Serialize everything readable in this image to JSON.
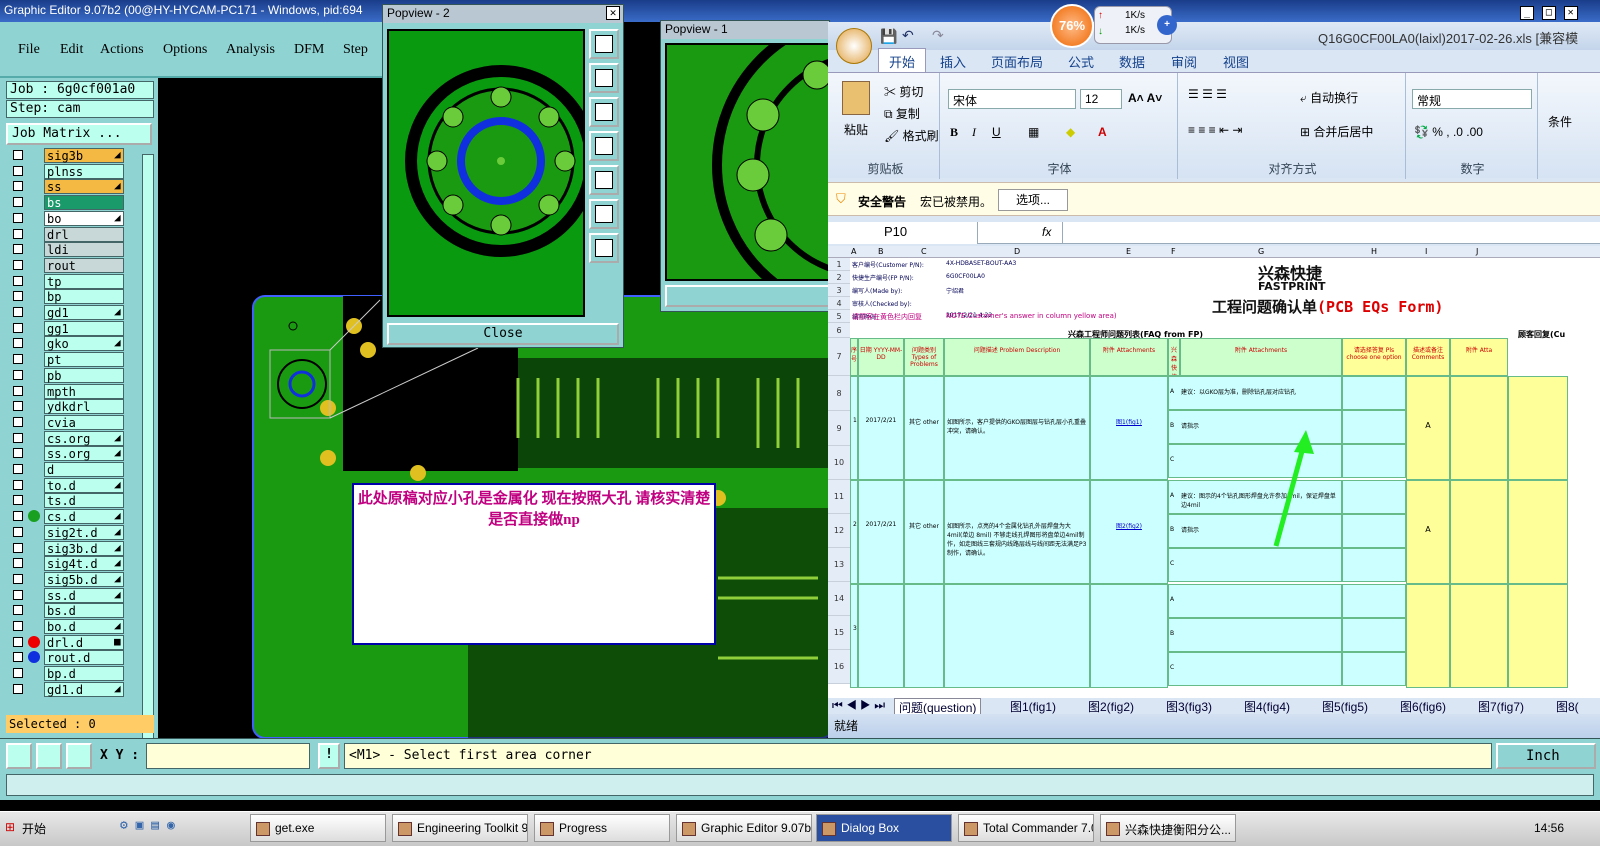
{
  "ge": {
    "title": "Graphic Editor 9.07b2 (00@HY-HYCAM-PC171 - Windows, pid:694",
    "menu": [
      "File",
      "Edit",
      "Actions",
      "Options",
      "Analysis",
      "DFM",
      "Step"
    ],
    "job": "Job : 6g0cf001a0",
    "step": "Step: cam",
    "job_matrix": "Job Matrix ...",
    "layers": [
      {
        "name": "sig3b",
        "bg": "#f4b942",
        "mk": "◢",
        "dot": ""
      },
      {
        "name": "plnss",
        "bg": "#bfe",
        "mk": "",
        "dot": ""
      },
      {
        "name": "ss",
        "bg": "#f4b942",
        "mk": "◢",
        "dot": ""
      },
      {
        "name": "bs",
        "bg": "#1a9a6a",
        "mk": "",
        "dot": ""
      },
      {
        "name": "bo",
        "bg": "#ffffff",
        "mk": "◢",
        "dot": ""
      },
      {
        "name": "drl",
        "bg": "#c8d8d8",
        "mk": "",
        "dot": ""
      },
      {
        "name": "ldi",
        "bg": "#c8d8d8",
        "mk": "",
        "dot": ""
      },
      {
        "name": "rout",
        "bg": "#c8d8d8",
        "mk": "",
        "dot": ""
      },
      {
        "name": "tp",
        "bg": "#bfe",
        "mk": "",
        "dot": ""
      },
      {
        "name": "bp",
        "bg": "#bfe",
        "mk": "",
        "dot": ""
      },
      {
        "name": "gd1",
        "bg": "#bfe",
        "mk": "◢",
        "dot": ""
      },
      {
        "name": "gg1",
        "bg": "#bfe",
        "mk": "",
        "dot": ""
      },
      {
        "name": "gko",
        "bg": "#bfe",
        "mk": "◢",
        "dot": ""
      },
      {
        "name": "pt",
        "bg": "#bfe",
        "mk": "",
        "dot": ""
      },
      {
        "name": "pb",
        "bg": "#bfe",
        "mk": "",
        "dot": ""
      },
      {
        "name": "mpth",
        "bg": "#bfe",
        "mk": "",
        "dot": ""
      },
      {
        "name": "ydkdrl",
        "bg": "#bfe",
        "mk": "",
        "dot": ""
      },
      {
        "name": "cvia",
        "bg": "#bfe",
        "mk": "",
        "dot": ""
      },
      {
        "name": "cs.org",
        "bg": "#bfe",
        "mk": "◢",
        "dot": ""
      },
      {
        "name": "ss.org",
        "bg": "#bfe",
        "mk": "◢",
        "dot": ""
      },
      {
        "name": "d",
        "bg": "#bfe",
        "mk": "",
        "dot": ""
      },
      {
        "name": "to.d",
        "bg": "#bfe",
        "mk": "◢",
        "dot": ""
      },
      {
        "name": "ts.d",
        "bg": "#bfe",
        "mk": "",
        "dot": ""
      },
      {
        "name": "cs.d",
        "bg": "#bfe",
        "mk": "◢",
        "dot": "#1aa020"
      },
      {
        "name": "sig2t.d",
        "bg": "#bfe",
        "mk": "◢",
        "dot": ""
      },
      {
        "name": "sig3b.d",
        "bg": "#bfe",
        "mk": "◢",
        "dot": ""
      },
      {
        "name": "sig4t.d",
        "bg": "#bfe",
        "mk": "◢",
        "dot": ""
      },
      {
        "name": "sig5b.d",
        "bg": "#bfe",
        "mk": "◢",
        "dot": ""
      },
      {
        "name": "ss.d",
        "bg": "#bfe",
        "mk": "◢",
        "dot": ""
      },
      {
        "name": "bs.d",
        "bg": "#bfe",
        "mk": "",
        "dot": ""
      },
      {
        "name": "bo.d",
        "bg": "#bfe",
        "mk": "◢",
        "dot": ""
      },
      {
        "name": "drl.d",
        "bg": "#bfe",
        "mk": "■",
        "dot": "#e00"
      },
      {
        "name": "rout.d",
        "bg": "#bfe",
        "mk": "",
        "dot": "#1030e0"
      },
      {
        "name": "bp.d",
        "bg": "#bfe",
        "mk": "",
        "dot": ""
      },
      {
        "name": "gd1.d",
        "bg": "#bfe",
        "mk": "◢",
        "dot": ""
      }
    ],
    "selected": "Selected : 0",
    "xy_label": "X Y :",
    "xy_value": "",
    "prompt": "<M1> - Select first area corner",
    "units": "Inch",
    "note": "此处原稿对应小孔是金属化   现在按照大孔  请核实清楚是否直接做np",
    "popview2": {
      "title": "Popview - 2",
      "close": "Close"
    },
    "popview1": {
      "title": "Popview - 1"
    },
    "netmeter": {
      "percent": "76%",
      "up": "1K/s",
      "down": "1K/s"
    }
  },
  "excel": {
    "title": "Q16G0CF00LA0(laixl)2017-02-26.xls  [兼容模",
    "tabs": [
      "开始",
      "插入",
      "页面布局",
      "公式",
      "数据",
      "审阅",
      "视图"
    ],
    "clipboard": {
      "paste": "粘贴",
      "cut": "剪切",
      "copy": "复制",
      "format_painter": "格式刷",
      "label": "剪贴板"
    },
    "font": {
      "name": "宋体",
      "size": "12",
      "label": "字体"
    },
    "align": {
      "wrap": "自动换行",
      "merge": "合并后居中",
      "label": "对齐方式"
    },
    "number": {
      "format": "常规",
      "label": "数字",
      "cond": "条件"
    },
    "security": {
      "title": "安全警告",
      "msg": "宏已被禁用。",
      "btn": "选项..."
    },
    "namebox": "P10",
    "fx": "fx",
    "col_heads": [
      "A",
      "B",
      "C",
      "D",
      "E",
      "F",
      "G",
      "H",
      "I",
      "J"
    ],
    "info_rows": [
      {
        "label": "客户编号(Customer P/N):",
        "value": "4X-HDBASET-BOUT-AA3"
      },
      {
        "label": "快捷生产编号(FP P/N):",
        "value": "6G0CF00LA0"
      },
      {
        "label": "编写人(Made by):",
        "value": "宁绍君"
      },
      {
        "label": "审核人(Checked by):",
        "value": ""
      },
      {
        "label": "编写时间",
        "value": "2017/2/21 4:22"
      }
    ],
    "note_row": "请顾客在黄色栏内回复",
    "note_en": "NOTE:Customer's answer in column yellow area)",
    "logo_cn": "兴森快捷",
    "logo_en": "FASTPRINT",
    "form_title": "工程问题确认单",
    "form_title_en": "(PCB EQs Form)",
    "section_fp": "兴森工程师问题列表(FAQ from FP)",
    "section_cust": "顾客回复(Cu",
    "headers": [
      "序号",
      "日期 YYYY-MM-DD",
      "问题类别 Types of Problems",
      "问题描述 Problem Description",
      "附件 Attachments",
      "兴森快捷建议 (Recommendation,suggestion)",
      "附件 Attachments",
      "请选择答复 Pls choose one option",
      "描述或备注 Comments",
      "附件 Atta"
    ],
    "rows": [
      {
        "no": "1",
        "date": "2017/2/21",
        "type": "其它 other",
        "desc": "如图所示，客户提供的GKO层图层与钻孔层小孔重叠冲突，请确认。",
        "att": "图1(fig1)",
        "a": "建议：以GKO层为准，删除钻孔层对应钻孔",
        "b": "请指示",
        "choice": "A"
      },
      {
        "no": "2",
        "date": "2017/2/21",
        "type": "其它 other",
        "desc": "如图所示，点亮的4个金属化钻孔外层焊盘为大4mil(单边 8mil) 不够走线孔焊图形将盘单边4mil制作，如走图线三套规内线路层线与线间距无法满足P3制作，请确认。",
        "att": "图2(fig2)",
        "a": "建议：图示的4个钻孔图形焊盘允许参加3mil，保证焊盘单边4mil",
        "b": "请指示",
        "choice": "A"
      },
      {
        "no": "3",
        "date": "",
        "type": "",
        "desc": "",
        "att": "",
        "a": "",
        "b": "",
        "choice": ""
      }
    ],
    "sheet_tabs": [
      "问题(question)",
      "图1(fig1)",
      "图2(fig2)",
      "图3(fig3)",
      "图4(fig4)",
      "图5(fig5)",
      "图6(fig6)",
      "图7(fig7)",
      "图8("
    ],
    "status": "就绪"
  },
  "taskbar": {
    "start": "开始",
    "items": [
      "get.exe",
      "Engineering Toolkit 9....",
      "Progress",
      "Graphic Editor 9.07b2...",
      "Dialog Box",
      "Total Commander 7.0...",
      "兴森快捷衡阳分公..."
    ],
    "clock": "14:56"
  }
}
